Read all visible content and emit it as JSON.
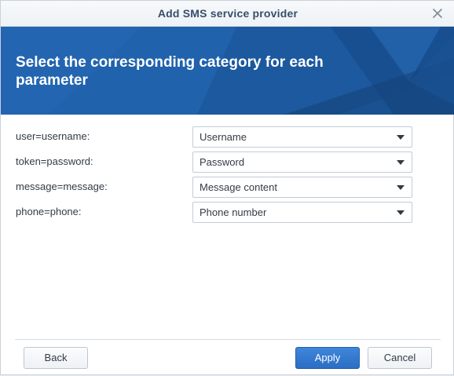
{
  "window": {
    "title": "Add SMS service provider"
  },
  "banner": {
    "heading": "Select the corresponding category for each parameter"
  },
  "parameters": [
    {
      "label": "user=username:",
      "value": "Username"
    },
    {
      "label": "token=password:",
      "value": "Password"
    },
    {
      "label": "message=message:",
      "value": "Message content"
    },
    {
      "label": "phone=phone:",
      "value": "Phone number"
    }
  ],
  "footer": {
    "back_label": "Back",
    "apply_label": "Apply",
    "cancel_label": "Cancel"
  },
  "colors": {
    "accent": "#2b6ec4",
    "banner": "#1f5fa8",
    "title_text": "#364e6b"
  },
  "icons": {
    "close": "close-icon",
    "dropdown": "chevron-down-icon"
  }
}
